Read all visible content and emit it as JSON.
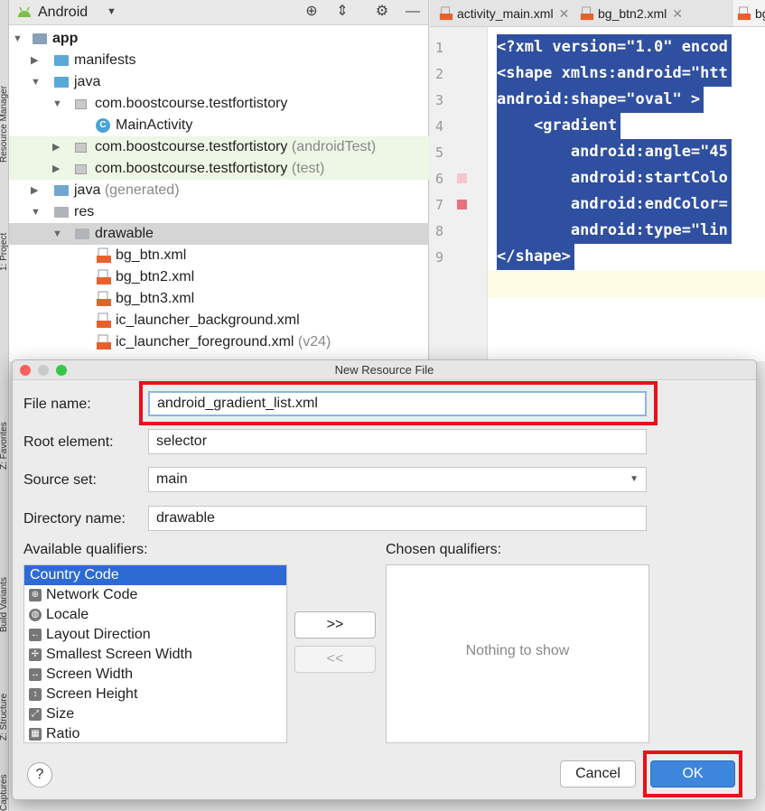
{
  "toolstrip": {
    "labels": [
      "Resource Manager",
      "1: Project",
      "Z: Favorites",
      "Build Variants",
      "Z: Structure",
      "Captures"
    ]
  },
  "project_panel": {
    "title": "Android",
    "tree": [
      {
        "label": "app",
        "extra": ""
      },
      {
        "label": "manifests",
        "extra": ""
      },
      {
        "label": "java",
        "extra": ""
      },
      {
        "label": "com.boostcourse.testfortistory",
        "extra": ""
      },
      {
        "label": "MainActivity",
        "extra": ""
      },
      {
        "label": "com.boostcourse.testfortistory",
        "extra": "(androidTest)"
      },
      {
        "label": "com.boostcourse.testfortistory",
        "extra": "(test)"
      },
      {
        "label": "java",
        "extra": "(generated)"
      },
      {
        "label": "res",
        "extra": ""
      },
      {
        "label": "drawable",
        "extra": ""
      },
      {
        "label": "bg_btn.xml",
        "extra": ""
      },
      {
        "label": "bg_btn2.xml",
        "extra": ""
      },
      {
        "label": "bg_btn3.xml",
        "extra": ""
      },
      {
        "label": "ic_launcher_background.xml",
        "extra": ""
      },
      {
        "label": "ic_launcher_foreground.xml",
        "extra": "(v24)"
      }
    ]
  },
  "editor": {
    "tabs": [
      {
        "label": "activity_main.xml"
      },
      {
        "label": "bg_btn2.xml"
      },
      {
        "label": "bg"
      }
    ],
    "lines": [
      {
        "num": "1",
        "code": "<?xml version=\"1.0\" encod"
      },
      {
        "num": "2",
        "code": "<shape xmlns:android=\"htt"
      },
      {
        "num": "3",
        "code": "android:shape=\"oval\" >"
      },
      {
        "num": "4",
        "code": "    <gradient"
      },
      {
        "num": "5",
        "code": "        android:angle=\"45"
      },
      {
        "num": "6",
        "code": "        android:startColo"
      },
      {
        "num": "7",
        "code": "        android:endColor="
      },
      {
        "num": "8",
        "code": "        android:type=\"lin"
      },
      {
        "num": "9",
        "code": "</shape>"
      }
    ],
    "colors": {
      "selection": "#2f4fa0",
      "start_marker": "#f6c6cc",
      "end_marker": "#e8717e"
    }
  },
  "dialog": {
    "title": "New Resource File",
    "file_name_label": "File name:",
    "file_name_value": "android_gradient_list.xml",
    "root_element_label": "Root element:",
    "root_element_value": "selector",
    "source_set_label": "Source set:",
    "source_set_value": "main",
    "directory_label": "Directory name:",
    "directory_value": "drawable",
    "available_label": "Available qualifiers:",
    "chosen_label": "Chosen qualifiers:",
    "available": [
      {
        "label": "Country Code",
        "icon": ""
      },
      {
        "label": "Network Code",
        "icon": "network-code-icon"
      },
      {
        "label": "Locale",
        "icon": "globe-icon"
      },
      {
        "label": "Layout Direction",
        "icon": "layout-direction-icon"
      },
      {
        "label": "Smallest Screen Width",
        "icon": "smallest-width-icon"
      },
      {
        "label": "Screen Width",
        "icon": "screen-width-icon"
      },
      {
        "label": "Screen Height",
        "icon": "screen-height-icon"
      },
      {
        "label": "Size",
        "icon": "size-icon"
      },
      {
        "label": "Ratio",
        "icon": "ratio-icon"
      }
    ],
    "chosen_empty": "Nothing to show",
    "add_button": ">>",
    "remove_button": "<<",
    "help_button": "?",
    "cancel_button": "Cancel",
    "ok_button": "OK"
  }
}
